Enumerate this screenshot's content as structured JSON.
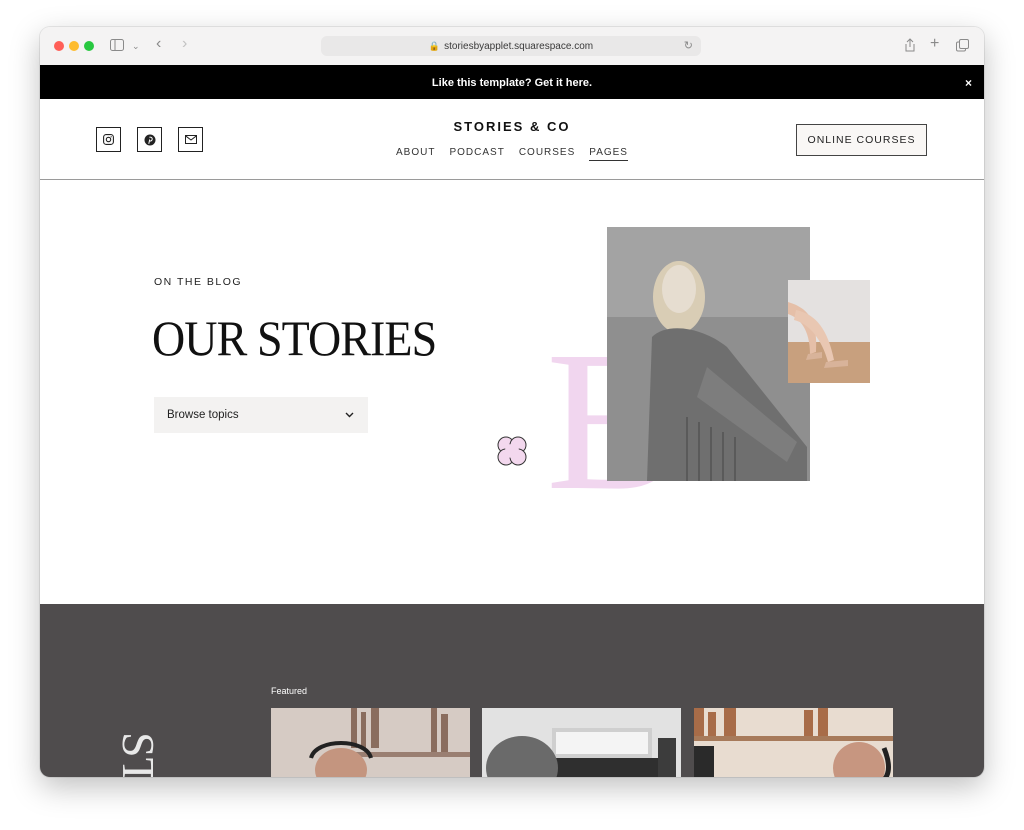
{
  "browser": {
    "url": "storiesbyapplet.squarespace.com"
  },
  "announcement": {
    "text": "Like this template? Get it here.",
    "close": "×"
  },
  "header": {
    "brand": "STORIES & CO",
    "nav": [
      "ABOUT",
      "PODCAST",
      "COURSES",
      "PAGES"
    ],
    "active_nav": "PAGES",
    "cta": "ONLINE COURSES",
    "social_icons": [
      "instagram-icon",
      "pinterest-icon",
      "mail-icon"
    ]
  },
  "hero": {
    "eyebrow": "ON THE BLOG",
    "title": "OUR STORIES",
    "dropdown": "Browse topics",
    "decor_letter": "B"
  },
  "featured": {
    "label": "Featured",
    "vertical_text": "ST"
  },
  "colors": {
    "accent_pink": "#f1d6ef",
    "dark_section": "#4f4c4d",
    "announcement_bg": "#000000"
  }
}
